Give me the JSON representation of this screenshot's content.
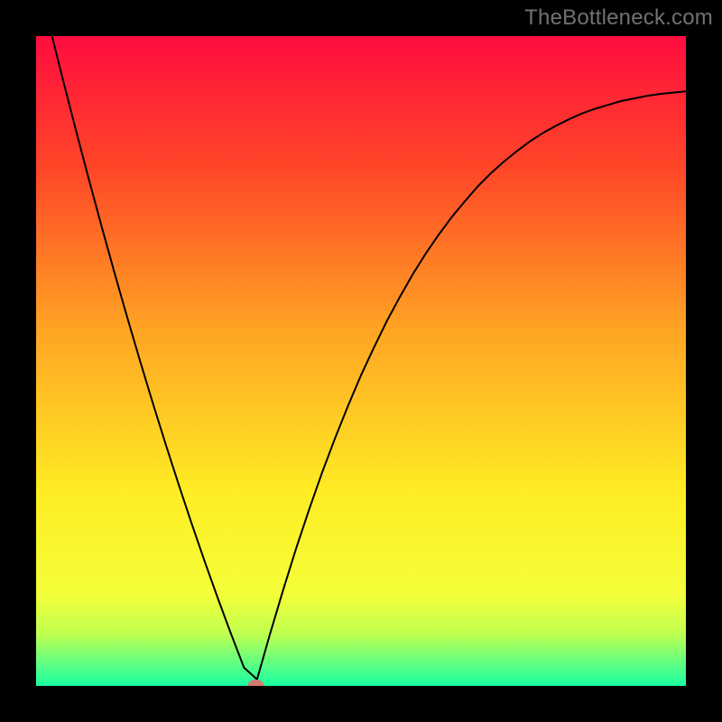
{
  "watermark": "TheBottleneck.com",
  "colors": {
    "gradient_stops": [
      {
        "offset": "0%",
        "color": "#ff0d3f"
      },
      {
        "offset": "20%",
        "color": "#ff4528"
      },
      {
        "offset": "45%",
        "color": "#ffa323"
      },
      {
        "offset": "70%",
        "color": "#ffec24"
      },
      {
        "offset": "86%",
        "color": "#f4ff3a"
      },
      {
        "offset": "92%",
        "color": "#c0ff50"
      },
      {
        "offset": "96%",
        "color": "#6aff7c"
      },
      {
        "offset": "100%",
        "color": "#19ffa1"
      }
    ],
    "curve": "#000000",
    "marker": "#d47a6e",
    "frame": "#000000"
  },
  "chart_data": {
    "type": "line",
    "x": [
      0.0,
      0.02,
      0.04,
      0.06,
      0.08,
      0.1,
      0.12,
      0.14,
      0.16,
      0.18,
      0.2,
      0.22,
      0.24,
      0.26,
      0.28,
      0.3,
      0.32,
      0.34,
      0.36,
      0.38,
      0.4,
      0.42,
      0.44,
      0.46,
      0.48,
      0.5,
      0.52,
      0.54,
      0.56,
      0.58,
      0.6,
      0.62,
      0.64,
      0.66,
      0.68,
      0.7,
      0.72,
      0.74,
      0.76,
      0.78,
      0.8,
      0.82,
      0.84,
      0.86,
      0.88,
      0.9,
      0.92,
      0.94,
      0.96,
      0.98,
      1.0
    ],
    "series": [
      {
        "name": "bottleneck",
        "values": [
          1.1,
          1.018,
          0.938,
          0.86,
          0.784,
          0.71,
          0.638,
          0.568,
          0.5,
          0.434,
          0.37,
          0.308,
          0.248,
          0.19,
          0.134,
          0.08,
          0.028,
          0.01,
          0.08,
          0.147,
          0.211,
          0.271,
          0.328,
          0.381,
          0.431,
          0.478,
          0.521,
          0.562,
          0.599,
          0.634,
          0.666,
          0.695,
          0.722,
          0.746,
          0.769,
          0.789,
          0.807,
          0.823,
          0.838,
          0.851,
          0.862,
          0.872,
          0.881,
          0.888,
          0.894,
          0.9,
          0.904,
          0.908,
          0.911,
          0.913,
          0.915
        ]
      }
    ],
    "xlim": [
      0,
      1
    ],
    "ylim": [
      0,
      1
    ],
    "optimal_point": {
      "x": 0.338,
      "y": 0.0
    },
    "title": "",
    "xlabel": "",
    "ylabel": ""
  }
}
